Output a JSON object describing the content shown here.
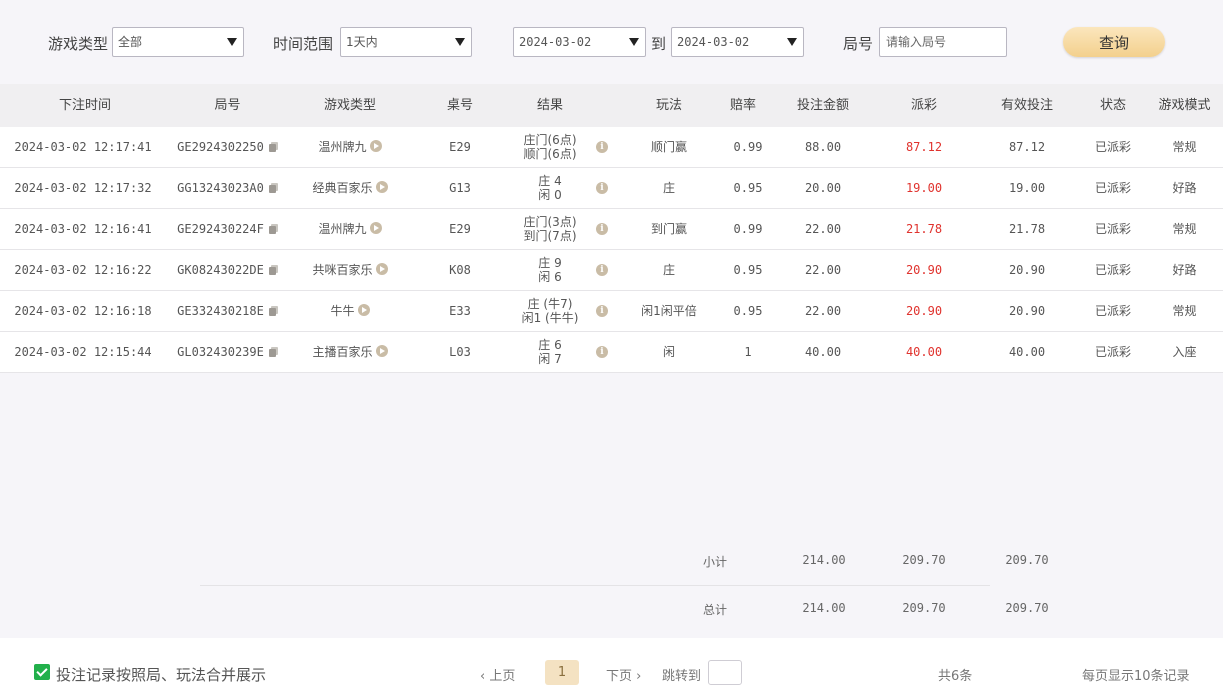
{
  "filters": {
    "game_type_label": "游戏类型",
    "game_type_value": "全部",
    "time_range_label": "时间范围",
    "time_range_value": "1天内",
    "date_from": "2024-03-02",
    "to_label": "到",
    "date_to": "2024-03-02",
    "round_label": "局号",
    "round_placeholder": "请输入局号",
    "query_button": "查询"
  },
  "table": {
    "headers": [
      "下注时间",
      "局号",
      "游戏类型",
      "桌号",
      "结果",
      "玩法",
      "赔率",
      "投注金额",
      "派彩",
      "有效投注",
      "状态",
      "游戏模式"
    ],
    "rows": [
      {
        "time": "2024-03-02 12:17:41",
        "round": "GE2924302250",
        "game": "温州牌九",
        "table": "E29",
        "result1": "庄门(6点)",
        "result2": "顺门(6点)",
        "play": "顺门赢",
        "odds": "0.99",
        "bet": "88.00",
        "payout": "87.12",
        "valid": "87.12",
        "status": "已派彩",
        "mode": "常规"
      },
      {
        "time": "2024-03-02 12:17:32",
        "round": "GG13243023A0",
        "game": "经典百家乐",
        "table": "G13",
        "result1": "庄 4",
        "result2": "闲 0",
        "play": "庄",
        "odds": "0.95",
        "bet": "20.00",
        "payout": "19.00",
        "valid": "19.00",
        "status": "已派彩",
        "mode": "好路"
      },
      {
        "time": "2024-03-02 12:16:41",
        "round": "GE292430224F",
        "game": "温州牌九",
        "table": "E29",
        "result1": "庄门(3点)",
        "result2": "到门(7点)",
        "play": "到门赢",
        "odds": "0.99",
        "bet": "22.00",
        "payout": "21.78",
        "valid": "21.78",
        "status": "已派彩",
        "mode": "常规"
      },
      {
        "time": "2024-03-02 12:16:22",
        "round": "GK08243022DE",
        "game": "共咪百家乐",
        "table": "K08",
        "result1": "庄 9",
        "result2": "闲 6",
        "play": "庄",
        "odds": "0.95",
        "bet": "22.00",
        "payout": "20.90",
        "valid": "20.90",
        "status": "已派彩",
        "mode": "好路"
      },
      {
        "time": "2024-03-02 12:16:18",
        "round": "GE332430218E",
        "game": "牛牛",
        "table": "E33",
        "result1": "庄 (牛7)",
        "result2": "闲1 (牛牛)",
        "play": "闲1闲平倍",
        "odds": "0.95",
        "bet": "22.00",
        "payout": "20.90",
        "valid": "20.90",
        "status": "已派彩",
        "mode": "常规"
      },
      {
        "time": "2024-03-02 12:15:44",
        "round": "GL032430239E",
        "game": "主播百家乐",
        "table": "L03",
        "result1": "庄 6",
        "result2": "闲 7",
        "play": "闲",
        "odds": "1",
        "bet": "40.00",
        "payout": "40.00",
        "valid": "40.00",
        "status": "已派彩",
        "mode": "入座"
      }
    ]
  },
  "totals": {
    "subtotal_label": "小计",
    "subtotal_bet": "214.00",
    "subtotal_payout": "209.70",
    "subtotal_valid": "209.70",
    "total_label": "总计",
    "total_bet": "214.00",
    "total_payout": "209.70",
    "total_valid": "209.70"
  },
  "footer": {
    "merge_label": "投注记录按照局、玩法合并展示",
    "prev": "‹ 上页",
    "page": "1",
    "next": "下页 ›",
    "jump_label": "跳转到",
    "count": "共6条",
    "per_page": "每页显示10条记录"
  },
  "colors": {
    "accent": "#f3d08d",
    "payout_red": "#e0332e",
    "checkbox_green": "#22b04b"
  },
  "icons": {
    "copy": "copy-icon",
    "play": "play-circle-icon",
    "info": "info-icon",
    "dropdown": "caret-down-icon",
    "checkbox": "checkbox-checked-icon"
  }
}
